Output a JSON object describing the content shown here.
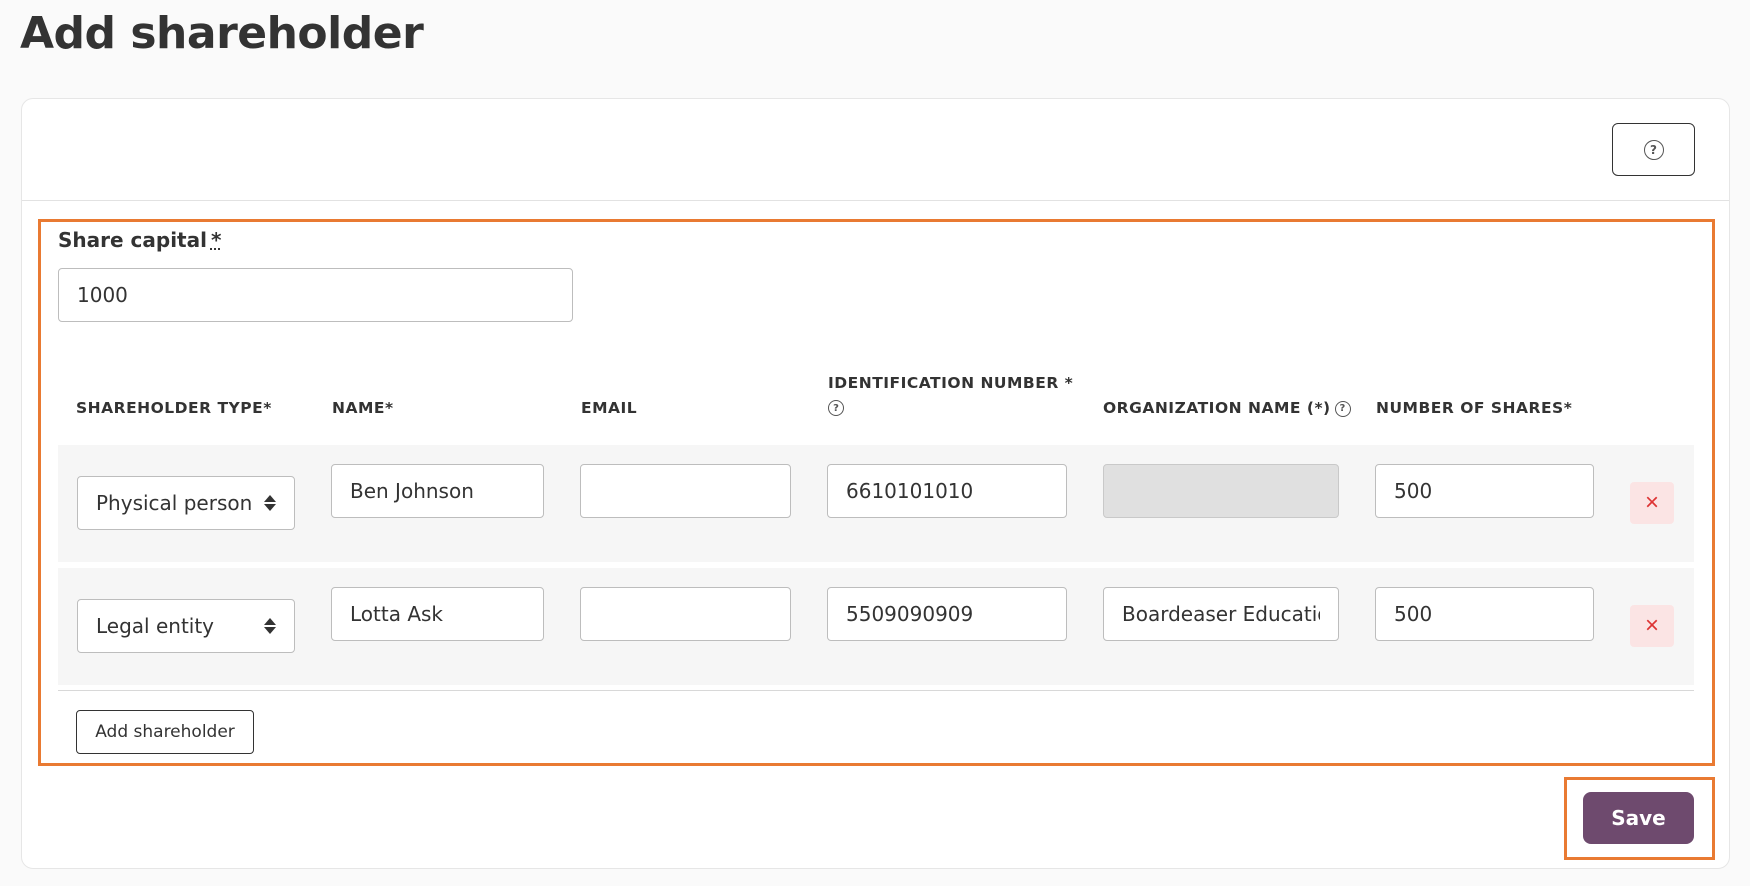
{
  "page": {
    "title": "Add shareholder"
  },
  "header": {
    "help_icon": "question-circle-icon"
  },
  "form": {
    "share_capital_label": "Share capital",
    "required_marker": "*",
    "share_capital_value": "1000",
    "columns": {
      "type": "SHAREHOLDER TYPE*",
      "name": "NAME*",
      "email": "EMAIL",
      "id_number": "IDENTIFICATION NUMBER *",
      "org_name": "ORGANIZATION NAME (*)",
      "shares": "NUMBER OF SHARES*"
    },
    "rows": [
      {
        "type": "Physical person",
        "name": "Ben Johnson",
        "email": "",
        "id_number": "6610101010",
        "org_name": "",
        "shares": "500",
        "org_disabled": true
      },
      {
        "type": "Legal entity",
        "name": "Lotta Ask",
        "email": "",
        "id_number": "5509090909",
        "org_name": "Boardeaser Education",
        "shares": "500",
        "org_disabled": false
      }
    ],
    "remove_icon": "close-icon",
    "add_button_label": "Add shareholder"
  },
  "footer": {
    "save_label": "Save"
  },
  "colors": {
    "accent_highlight": "#e97a32",
    "primary_button": "#6e4a6e",
    "remove_button_bg": "#fbe4e4",
    "remove_icon": "#d33333"
  }
}
